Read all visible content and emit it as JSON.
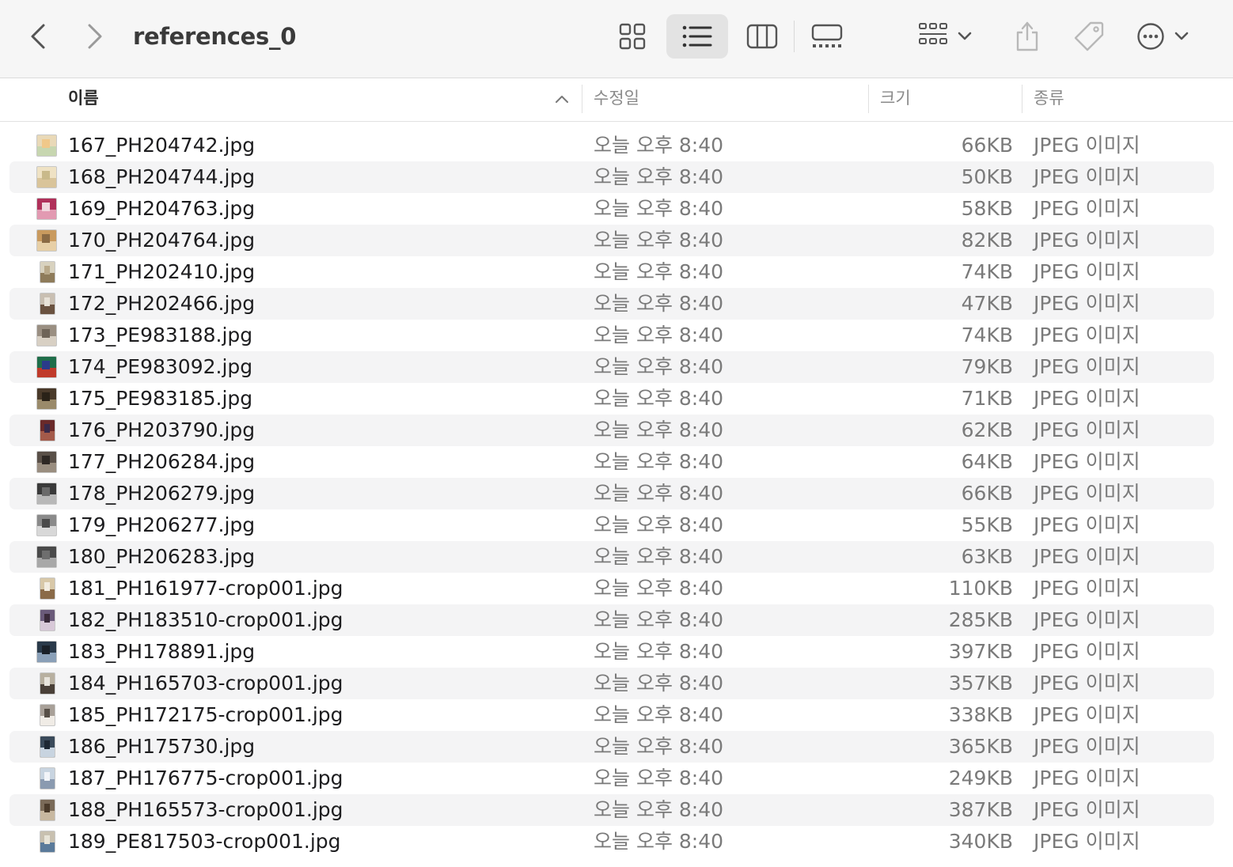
{
  "window": {
    "title": "references_0"
  },
  "toolbar": {
    "back": "chevron-left-icon",
    "forward": "chevron-right-icon",
    "views": [
      "icon-view",
      "list-view",
      "column-view",
      "gallery-view"
    ],
    "active_view": "list-view"
  },
  "columns": {
    "name": "이름",
    "date": "수정일",
    "size": "크기",
    "kind": "종류"
  },
  "accent": "#e3e3e3",
  "files": [
    {
      "name": "167_PH204742.jpg",
      "date": "오늘 오후 8:40",
      "size": "66KB",
      "kind": "JPEG 이미지"
    },
    {
      "name": "168_PH204744.jpg",
      "date": "오늘 오후 8:40",
      "size": "50KB",
      "kind": "JPEG 이미지"
    },
    {
      "name": "169_PH204763.jpg",
      "date": "오늘 오후 8:40",
      "size": "58KB",
      "kind": "JPEG 이미지"
    },
    {
      "name": "170_PH204764.jpg",
      "date": "오늘 오후 8:40",
      "size": "82KB",
      "kind": "JPEG 이미지"
    },
    {
      "name": "171_PH202410.jpg",
      "date": "오늘 오후 8:40",
      "size": "74KB",
      "kind": "JPEG 이미지"
    },
    {
      "name": "172_PH202466.jpg",
      "date": "오늘 오후 8:40",
      "size": "47KB",
      "kind": "JPEG 이미지"
    },
    {
      "name": "173_PE983188.jpg",
      "date": "오늘 오후 8:40",
      "size": "74KB",
      "kind": "JPEG 이미지"
    },
    {
      "name": "174_PE983092.jpg",
      "date": "오늘 오후 8:40",
      "size": "79KB",
      "kind": "JPEG 이미지"
    },
    {
      "name": "175_PE983185.jpg",
      "date": "오늘 오후 8:40",
      "size": "71KB",
      "kind": "JPEG 이미지"
    },
    {
      "name": "176_PH203790.jpg",
      "date": "오늘 오후 8:40",
      "size": "62KB",
      "kind": "JPEG 이미지"
    },
    {
      "name": "177_PH206284.jpg",
      "date": "오늘 오후 8:40",
      "size": "64KB",
      "kind": "JPEG 이미지"
    },
    {
      "name": "178_PH206279.jpg",
      "date": "오늘 오후 8:40",
      "size": "66KB",
      "kind": "JPEG 이미지"
    },
    {
      "name": "179_PH206277.jpg",
      "date": "오늘 오후 8:40",
      "size": "55KB",
      "kind": "JPEG 이미지"
    },
    {
      "name": "180_PH206283.jpg",
      "date": "오늘 오후 8:40",
      "size": "63KB",
      "kind": "JPEG 이미지"
    },
    {
      "name": "181_PH161977-crop001.jpg",
      "date": "오늘 오후 8:40",
      "size": "110KB",
      "kind": "JPEG 이미지"
    },
    {
      "name": "182_PH183510-crop001.jpg",
      "date": "오늘 오후 8:40",
      "size": "285KB",
      "kind": "JPEG 이미지"
    },
    {
      "name": "183_PH178891.jpg",
      "date": "오늘 오후 8:40",
      "size": "397KB",
      "kind": "JPEG 이미지"
    },
    {
      "name": "184_PH165703-crop001.jpg",
      "date": "오늘 오후 8:40",
      "size": "357KB",
      "kind": "JPEG 이미지"
    },
    {
      "name": "185_PH172175-crop001.jpg",
      "date": "오늘 오후 8:40",
      "size": "338KB",
      "kind": "JPEG 이미지"
    },
    {
      "name": "186_PH175730.jpg",
      "date": "오늘 오후 8:40",
      "size": "365KB",
      "kind": "JPEG 이미지"
    },
    {
      "name": "187_PH176775-crop001.jpg",
      "date": "오늘 오후 8:40",
      "size": "249KB",
      "kind": "JPEG 이미지"
    },
    {
      "name": "188_PH165573-crop001.jpg",
      "date": "오늘 오후 8:40",
      "size": "387KB",
      "kind": "JPEG 이미지"
    },
    {
      "name": "189_PE817503-crop001.jpg",
      "date": "오늘 오후 8:40",
      "size": "340KB",
      "kind": "JPEG 이미지"
    }
  ]
}
